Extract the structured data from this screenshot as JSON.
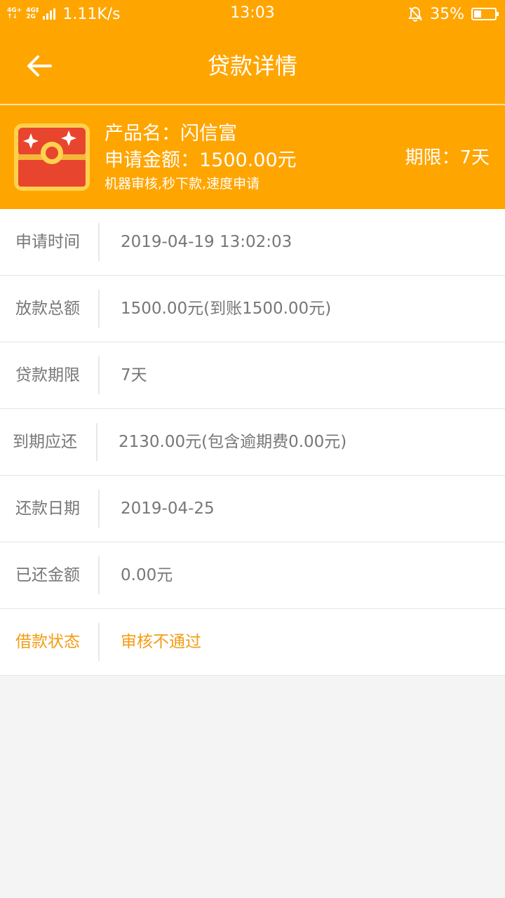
{
  "status_bar": {
    "net1_top": "4G+",
    "net1_bottom": "↑↓",
    "net2_top": "4G‡",
    "net2_bottom": "2G",
    "speed": "1.11K/s",
    "time": "13:03",
    "battery": "35%",
    "battery_level": 0.35
  },
  "header": {
    "title": "贷款详情"
  },
  "product": {
    "name": "产品名：闪信富",
    "amount": "申请金额：1500.00元",
    "tags": "机器审核,秒下款,速度申请",
    "term": "期限：7天"
  },
  "details": [
    {
      "label": "申请时间",
      "value": "2019-04-19 13:02:03"
    },
    {
      "label": "放款总额",
      "value": "1500.00元(到账1500.00元)"
    },
    {
      "label": "贷款期限",
      "value": "7天"
    },
    {
      "label": "到期应还",
      "value": "2130.00元(包含逾期费0.00元)"
    },
    {
      "label": "还款日期",
      "value": "2019-04-25"
    },
    {
      "label": "已还金额",
      "value": "0.00元"
    },
    {
      "label": "借款状态",
      "value": "审核不通过"
    }
  ],
  "colors": {
    "primary": "#ffa500",
    "status_text": "#f39c12",
    "label_text": "#777777"
  }
}
